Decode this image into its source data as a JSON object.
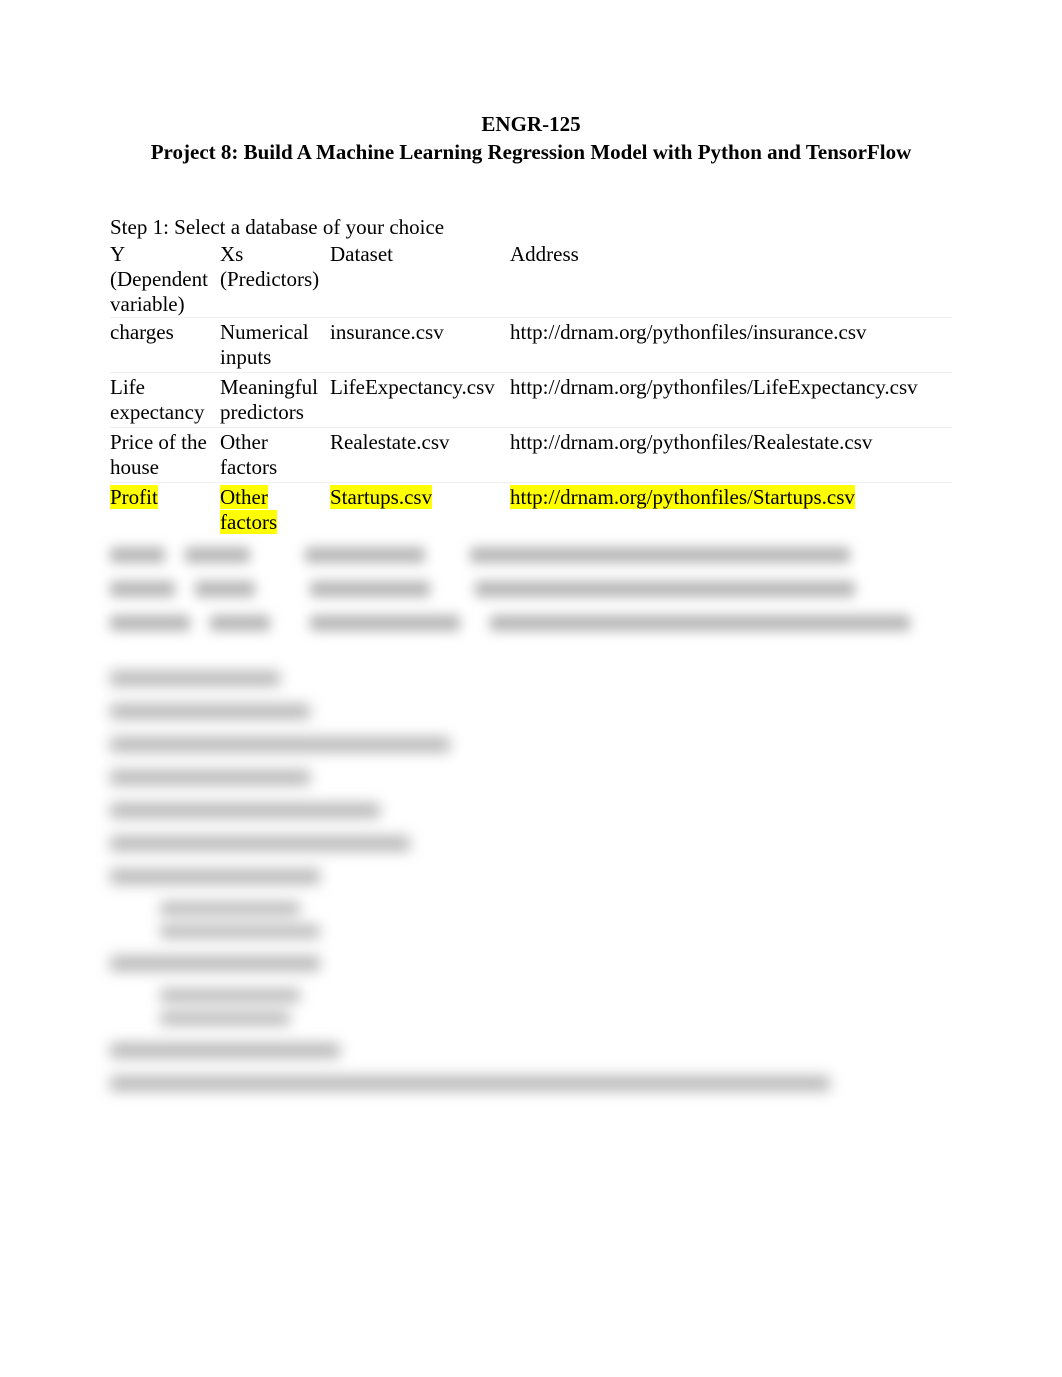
{
  "header": {
    "course": "ENGR-125",
    "title": "Project 8: Build A Machine Learning Regression Model with Python and TensorFlow"
  },
  "step1_label": "Step 1: Select a database of your choice",
  "table": {
    "headers": {
      "y": "Y (Dependent variable)",
      "xs": "Xs (Predictors)",
      "dataset": "Dataset",
      "address": "Address"
    },
    "rows": [
      {
        "y": "charges",
        "xs": "Numerical inputs",
        "dataset": "insurance.csv",
        "address": "http://drnam.org/pythonfiles/insurance.csv",
        "highlight": false
      },
      {
        "y": "Life expectancy",
        "xs": "Meaningful predictors",
        "dataset": "LifeExpectancy.csv",
        "address": "http://drnam.org/pythonfiles/LifeExpectancy.csv",
        "highlight": false
      },
      {
        "y": "Price of the house",
        "xs": "Other factors",
        "dataset": "Realestate.csv",
        "address": "http://drnam.org/pythonfiles/Realestate.csv",
        "highlight": false
      },
      {
        "y": "Profit",
        "xs": "Other factors",
        "dataset": "Startups.csv",
        "address": "http://drnam.org/pythonfiles/Startups.csv",
        "highlight": true
      }
    ]
  }
}
